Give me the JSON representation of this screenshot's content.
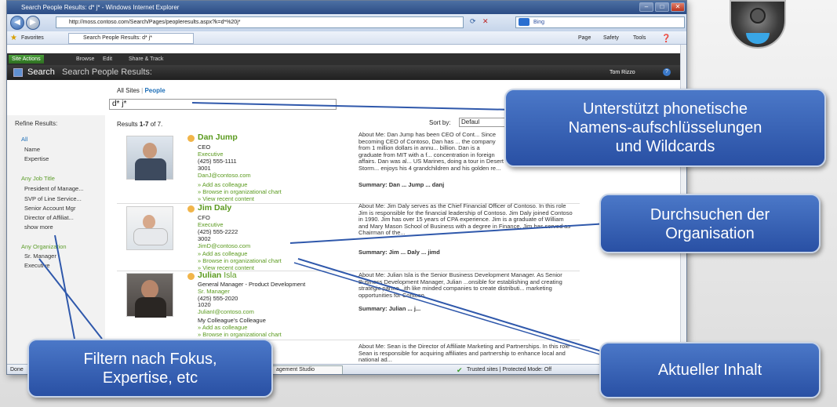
{
  "browser": {
    "window_title": "Search People Results: d* j* - Windows Internet Explorer",
    "address": "http://moss.contoso.com/Search/Pages/peopleresults.aspx?k=d*%20j*",
    "search_provider": "Bing",
    "favorites_label": "Favorites",
    "tab_label": "Search People Results: d* j*",
    "commands": [
      "Page",
      "Safety",
      "Tools"
    ],
    "status_left": "Done",
    "status_app": "agement Studio",
    "status_zone": "Trusted sites | Protected Mode: Off"
  },
  "sharepoint": {
    "site_actions": "Site Actions",
    "ribbon_tabs": [
      "Browse",
      "Edit",
      "Share & Track"
    ],
    "breadcrumb_root": "Search",
    "page_title": "Search People Results:",
    "user": "Tom Rizzo",
    "scope_all": "All Sites",
    "scope_people": "People",
    "query": "d* j*",
    "results_count": "Results 1-7 of 7.",
    "results_prefix": "Results ",
    "results_range": "1-7",
    "results_suffix": " of 7.",
    "sort_by_label": "Sort by:",
    "sort_by_value": "Defaul"
  },
  "refine": {
    "title": "Refine Results:",
    "sections": [
      {
        "items": [
          "All",
          "Name",
          "Expertise"
        ]
      },
      {
        "heading": "Any Job Title",
        "items": [
          "President of Manage...",
          "SVP of Line Service...",
          "Senior Account Mgr",
          "Director of Affiliat..."
        ],
        "more": "show more"
      },
      {
        "heading": "Any Organization",
        "items": [
          "Sr. Manager",
          "Executive"
        ]
      }
    ]
  },
  "results": [
    {
      "first": "Dan",
      "last": "Jump",
      "title": "CEO",
      "role": "Executive",
      "phone": "(425) 555-1111",
      "office": "3001",
      "email": "DanJ@contoso.com",
      "links": [
        "» Add as colleague",
        "» Browse in organizational chart",
        "» View recent content"
      ],
      "about": "About Me: Dan Jump has been CEO of Cont... Since becoming CEO of Contoso, Dan has ... the company from 1 million dollars in annu... billion. Dan is a graduate from MIT with a f... concentration in foreign affairs. Dan was al... US Marines, doing a tour in Desert Storm... enjoys his 4 grandchildren and his golden re...",
      "summary": "Summary: Dan ... Jump ... danj"
    },
    {
      "first": "Jim",
      "last": "Daly",
      "title": "CFO",
      "role": "Executive",
      "phone": "(425) 555-2222",
      "office": "3002",
      "email": "JimD@contoso.com",
      "links": [
        "» Add as colleague",
        "» Browse in organizational chart",
        "» View recent content"
      ],
      "about": "About Me: Jim Daly serves as the Chief Financial Officer of Contoso. In this role Jim is responsible for the financial leadership of Contoso. Jim Daly joined Contoso in 1990. Jim has over 15 years of CPA experience. Jim is a graduate of William and Mary Mason School of Business with a degree in Finance. Jim has served as Chairman of the...",
      "summary": "Summary: Jim ... Daly ... jimd"
    },
    {
      "first": "Julian",
      "last": "Isla",
      "title": "General Manager - Product Development",
      "role": "Sr. Manager",
      "phone": "(425) 555-2020",
      "office": "1020",
      "email": "JulianI@contoso.com",
      "colleague_note": "My Colleague's Colleague",
      "links": [
        "» Add as colleague",
        "» Browse in organizational chart"
      ],
      "about": "About Me: Julian Isla is the Senior Business Development Manager. As Senior Business Development Manager, Julian ...onsible for establishing and creating strategic partne...ith like minded companies to create distributi... marketing opportunities for Contoso.",
      "summary": "Summary: Julian ... j..."
    },
    {
      "title_partial": "gement",
      "about": "About Me: Sean is the Director of Affiliate Marketing and Partnerships. In this role Sean is responsible for acquiring affiliates and partnership to enhance local and national ad..."
    }
  ],
  "callouts": {
    "phonetic": [
      "Unterstützt phonetische",
      "Namens-aufschlüsselungen",
      "und Wildcards"
    ],
    "org": [
      "Durchsuchen der",
      "Organisation"
    ],
    "filter": [
      "Filtern nach Fokus,",
      "Expertise, etc"
    ],
    "recent": "Aktueller Inhalt"
  },
  "colors": {
    "callout_fill": "#2f58ab",
    "accent_green": "#5a9a1e",
    "chrome_dark": "#2b2b2b"
  }
}
